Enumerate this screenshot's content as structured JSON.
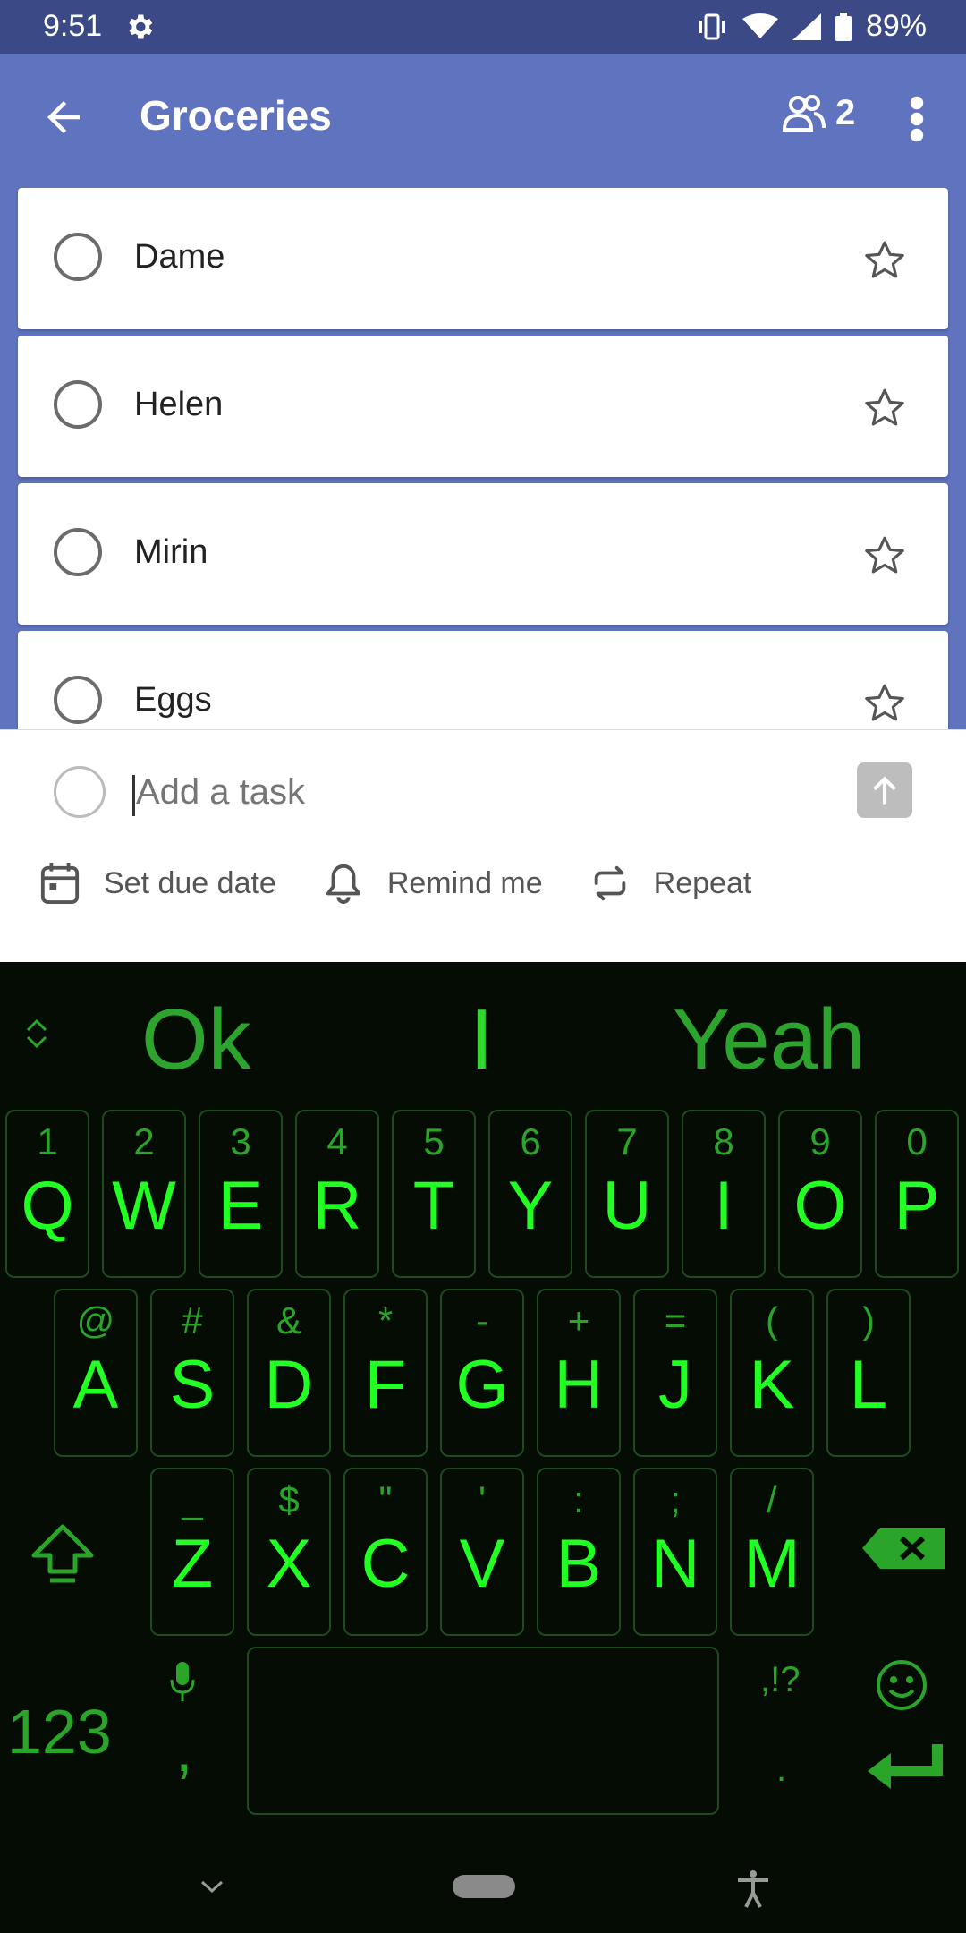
{
  "status_bar": {
    "time": "9:51",
    "battery": "89%",
    "icons": [
      "settings-gear-icon",
      "vibrate-icon",
      "wifi-icon",
      "signal-icon",
      "battery-icon"
    ]
  },
  "app_bar": {
    "title": "Groceries",
    "member_count": "2",
    "color": "#5F73BF"
  },
  "tasks": [
    {
      "label": "Dame"
    },
    {
      "label": "Helen"
    },
    {
      "label": "Mirin"
    },
    {
      "label": "Eggs"
    }
  ],
  "add_task": {
    "placeholder": "Add a task",
    "options": {
      "due": "Set due date",
      "remind": "Remind me",
      "repeat": "Repeat"
    }
  },
  "keyboard": {
    "suggestions": [
      "Ok",
      "I",
      "Yeah"
    ],
    "row1": [
      {
        "sub": "1",
        "main": "Q"
      },
      {
        "sub": "2",
        "main": "W"
      },
      {
        "sub": "3",
        "main": "E"
      },
      {
        "sub": "4",
        "main": "R"
      },
      {
        "sub": "5",
        "main": "T"
      },
      {
        "sub": "6",
        "main": "Y"
      },
      {
        "sub": "7",
        "main": "U"
      },
      {
        "sub": "8",
        "main": "I"
      },
      {
        "sub": "9",
        "main": "O"
      },
      {
        "sub": "0",
        "main": "P"
      }
    ],
    "row2": [
      {
        "sub": "@",
        "main": "A"
      },
      {
        "sub": "#",
        "main": "S"
      },
      {
        "sub": "&",
        "main": "D"
      },
      {
        "sub": "*",
        "main": "F"
      },
      {
        "sub": "-",
        "main": "G"
      },
      {
        "sub": "+",
        "main": "H"
      },
      {
        "sub": "=",
        "main": "J"
      },
      {
        "sub": "(",
        "main": "K"
      },
      {
        "sub": ")",
        "main": "L"
      }
    ],
    "row3": [
      {
        "sub": "_",
        "main": "Z"
      },
      {
        "sub": "$",
        "main": "X"
      },
      {
        "sub": "\"",
        "main": "C"
      },
      {
        "sub": "'",
        "main": "V"
      },
      {
        "sub": ":",
        "main": "B"
      },
      {
        "sub": ";",
        "main": "N"
      },
      {
        "sub": "/",
        "main": "M"
      }
    ],
    "numbers_key": "123",
    "comma": ",",
    "punct": ",!?",
    "period": ".",
    "accent_color": "#21FF21"
  }
}
